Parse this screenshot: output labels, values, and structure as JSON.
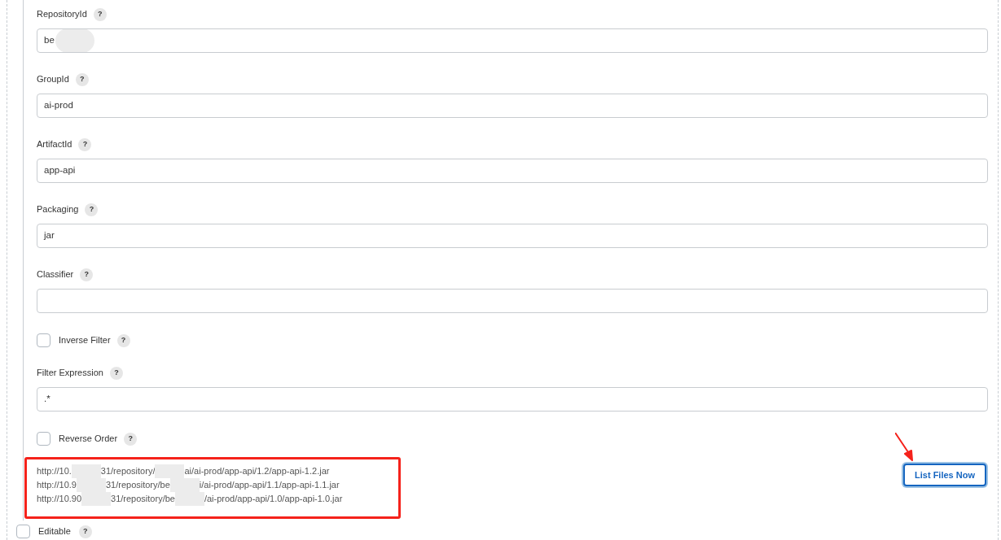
{
  "fields": [
    {
      "kind": "text",
      "label": "RepositoryId",
      "help": "?",
      "value": "be"
    },
    {
      "kind": "text",
      "label": "GroupId",
      "help": "?",
      "value": "ai-prod"
    },
    {
      "kind": "text",
      "label": "ArtifactId",
      "help": "?",
      "value": "app-api"
    },
    {
      "kind": "text",
      "label": "Packaging",
      "help": "?",
      "value": "jar"
    },
    {
      "kind": "text",
      "label": "Classifier",
      "help": "?"
    },
    {
      "kind": "checkbox",
      "label": "Inverse Filter",
      "help": "?",
      "checked": false
    },
    {
      "kind": "text",
      "label": "Filter Expression",
      "help": "?",
      "value": ".*"
    },
    {
      "kind": "checkbox",
      "label": "Reverse Order",
      "help": "?",
      "checked": false
    }
  ],
  "file_list": [
    {
      "parts": [
        "http://10.",
        "31/repository/",
        "ai/ai-prod/app-api/1.2/app-api-1.2.jar"
      ]
    },
    {
      "parts": [
        "http://10.9",
        "31/repository/be",
        "i/ai-prod/app-api/1.1/app-api-1.1.jar"
      ]
    },
    {
      "parts": [
        "http://10.90",
        "31/repository/be",
        "/ai-prod/app-api/1.0/app-api-1.0.jar"
      ]
    }
  ],
  "list_button": "List Files Now",
  "editable": {
    "label": "Editable",
    "help": "?",
    "checked": false
  }
}
